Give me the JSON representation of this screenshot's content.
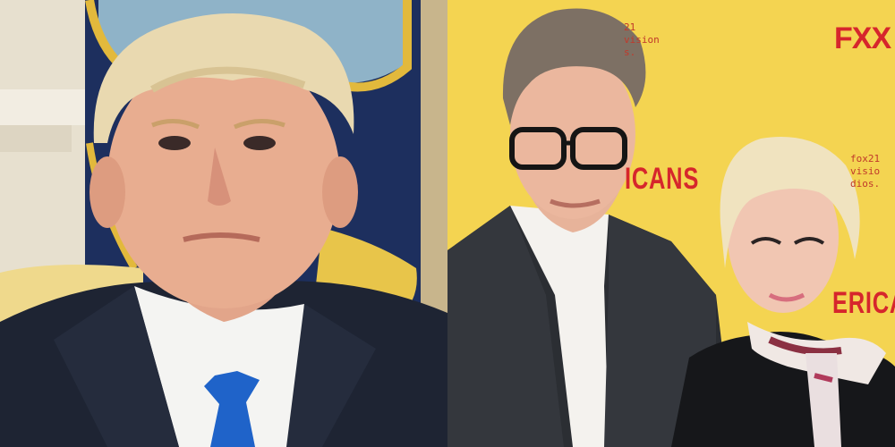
{
  "backdrop": {
    "logo": "FXX",
    "network_text_top": "21\nvision\ns.",
    "network_text_right": "fox21\nvisio\ndios.",
    "title_fragment_1": "ICANS",
    "title_fragment_2": "ERICA"
  },
  "colors": {
    "backdrop_yellow": "#f3d24a",
    "logo_red": "#d6262c",
    "tie_blue": "#1f63c9",
    "navy_flag": "#1d2f5e"
  }
}
